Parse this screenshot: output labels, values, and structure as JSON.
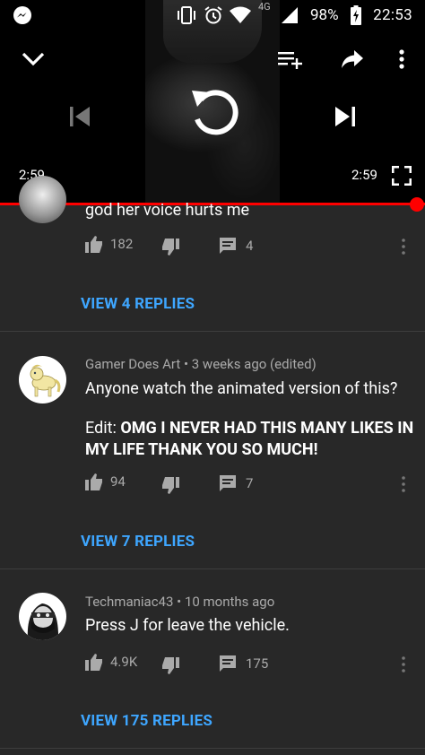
{
  "status_bar": {
    "network": "4G",
    "battery_percent": "98%",
    "time": "22:53"
  },
  "player": {
    "elapsed": "2:59",
    "duration": "2:59",
    "progress": 1.0
  },
  "partial_comment": {
    "text": "god her voice hurts me",
    "likes": "182",
    "replies": "4",
    "view_replies": "VIEW 4 REPLIES"
  },
  "comments": [
    {
      "author": "Gamer Does Art",
      "time": "3 weeks ago (edited)",
      "text": "Anyone watch the animated version of this?",
      "edit_prefix": "Edit: ",
      "edit_bold": "OMG I NEVER HAD THIS MANY LIKES IN MY LIFE THANK YOU SO MUCH!",
      "likes": "94",
      "replies": "7",
      "view_replies": "VIEW 7 REPLIES"
    },
    {
      "author": "Techmaniac43",
      "time": "10 months ago",
      "text": "Press J for leave the vehicle.",
      "likes": "4.9K",
      "replies": "175",
      "view_replies": "VIEW 175 REPLIES"
    }
  ],
  "meta_separator": " • ",
  "colors": {
    "background": "#282828",
    "link": "#3ea6ff",
    "progress": "#ff0000",
    "secondary_text": "#aaaaaa"
  }
}
